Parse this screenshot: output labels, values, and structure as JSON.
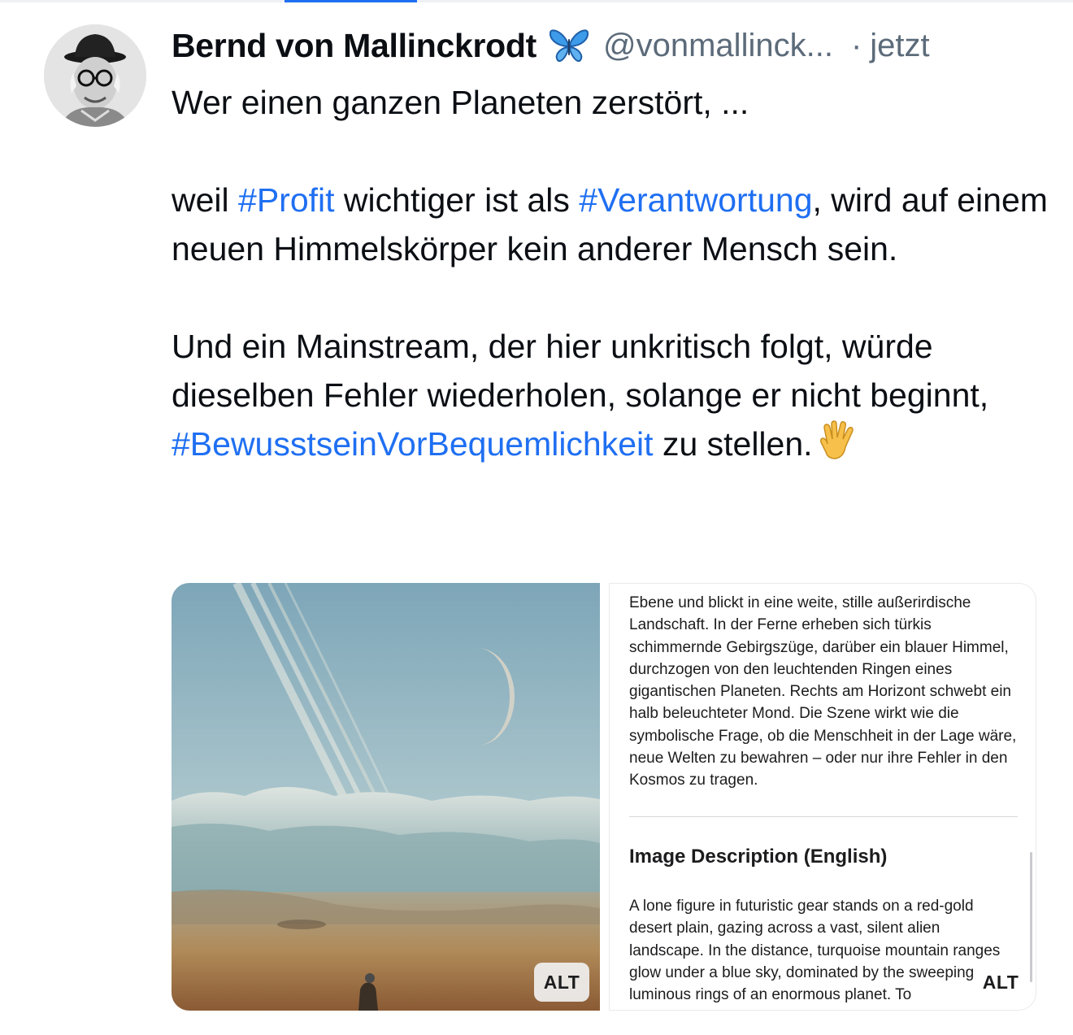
{
  "post": {
    "author": {
      "display_name": "Bernd von Mallinckrodt",
      "badge_icon": "butterfly-icon",
      "handle": "@vonmallinck...",
      "separator": "·",
      "time": "jetzt"
    },
    "text": {
      "line1": "Wer einen ganzen Planeten zerstört, ...",
      "p2_part1": "weil ",
      "p2_tag1": "#Profit",
      "p2_part2": " wichtiger ist als ",
      "p2_tag2": "#Verantwortung",
      "p2_part3": ", wird auf einem neuen Himmelskörper kein anderer Mensch sein.",
      "p3_part1": "Und ein Mainstream, der hier unkritisch folgt, würde dieselben Fehler wiederholen, solange er nicht beginnt, ",
      "p3_tag": "#BewusstseinVorBequemlichkeit",
      "p3_part2": " zu stellen.",
      "emoji_icon": "vulcan-salute-icon"
    },
    "media": {
      "left_alt_label": "ALT",
      "right_alt_label": "ALT",
      "description_de": "Ebene und blickt in eine weite, stille außerirdische Landschaft. In der Ferne erheben sich türkis schimmernde Gebirgszüge, darüber ein blauer Himmel, durchzogen von den leuchtenden Ringen eines gigantischen Planeten. Rechts am Horizont schwebt ein halb beleuchteter Mond. Die Szene wirkt wie die symbolische Frage, ob die Menschheit in der Lage wäre, neue Welten zu bewahren – oder nur ihre Fehler in den Kosmos zu tragen.",
      "heading_en": "Image Description (English)",
      "description_en": "A lone figure in futuristic gear stands on a red-gold desert plain, gazing across a vast, silent alien landscape. In the distance, turquoise mountain ranges glow under a blue sky, dominated by the sweeping luminous rings of an enormous planet. To"
    }
  },
  "colors": {
    "link": "#1f6ff2",
    "muted": "#5c6b7a",
    "text": "#0b0f14"
  }
}
